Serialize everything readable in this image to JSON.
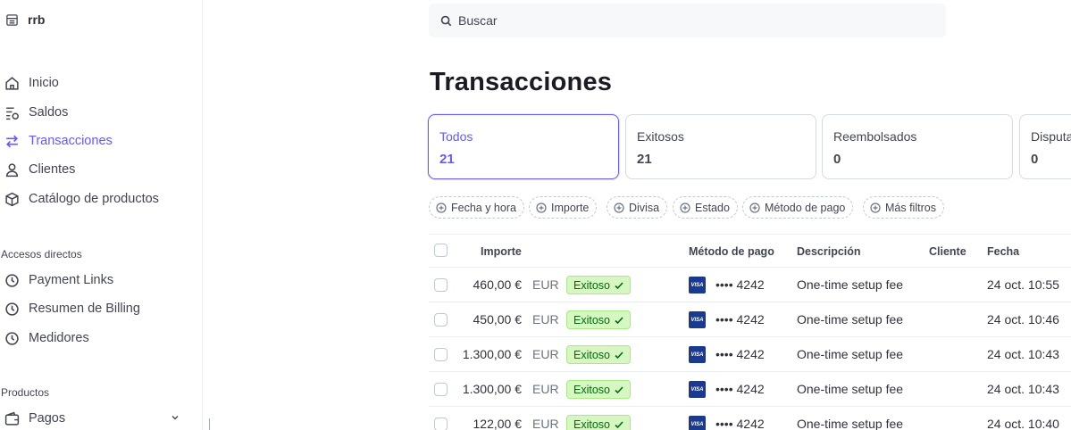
{
  "account": {
    "name": "rrb"
  },
  "nav": {
    "items": [
      {
        "label": "Inicio",
        "icon": "home-icon"
      },
      {
        "label": "Saldos",
        "icon": "balances-icon"
      },
      {
        "label": "Transacciones",
        "icon": "arrows-swap-icon",
        "active": true
      },
      {
        "label": "Clientes",
        "icon": "person-icon"
      },
      {
        "label": "Catálogo de productos",
        "icon": "box-icon"
      }
    ],
    "shortcuts_label": "Accesos directos",
    "shortcuts": [
      {
        "label": "Payment Links",
        "icon": "clock-icon"
      },
      {
        "label": "Resumen de Billing",
        "icon": "clock-icon"
      },
      {
        "label": "Medidores",
        "icon": "clock-icon"
      }
    ],
    "products_label": "Productos",
    "products": [
      {
        "label": "Pagos",
        "icon": "wallet-icon"
      }
    ]
  },
  "search": {
    "placeholder": "Buscar"
  },
  "page": {
    "title": "Transacciones"
  },
  "status_cards": [
    {
      "label": "Todos",
      "count": "21",
      "active": true
    },
    {
      "label": "Exitosos",
      "count": "21"
    },
    {
      "label": "Reembolsados",
      "count": "0"
    },
    {
      "label": "Disputa",
      "count": "0"
    }
  ],
  "filters": [
    "Fecha y hora",
    "Importe",
    "Divisa",
    "Estado",
    "Método de pago",
    "Más filtros"
  ],
  "table": {
    "headers": {
      "amount": "Importe",
      "payment_method": "Método de pago",
      "description": "Descripción",
      "customer": "Cliente",
      "date": "Fecha"
    },
    "rows": [
      {
        "amount": "460,00 €",
        "currency": "EUR",
        "status": "Exitoso",
        "card_brand": "VISA",
        "card": "•••• 4242",
        "description": "One-time setup fee",
        "customer": "",
        "date": "24 oct. 10:55"
      },
      {
        "amount": "450,00 €",
        "currency": "EUR",
        "status": "Exitoso",
        "card_brand": "VISA",
        "card": "•••• 4242",
        "description": "One-time setup fee",
        "customer": "",
        "date": "24 oct. 10:46"
      },
      {
        "amount": "1.300,00 €",
        "currency": "EUR",
        "status": "Exitoso",
        "card_brand": "VISA",
        "card": "•••• 4242",
        "description": "One-time setup fee",
        "customer": "",
        "date": "24 oct. 10:43"
      },
      {
        "amount": "1.300,00 €",
        "currency": "EUR",
        "status": "Exitoso",
        "card_brand": "VISA",
        "card": "•••• 4242",
        "description": "One-time setup fee",
        "customer": "",
        "date": "24 oct. 10:43"
      },
      {
        "amount": "122,00 €",
        "currency": "EUR",
        "status": "Exitoso",
        "card_brand": "VISA",
        "card": "•••• 4242",
        "description": "One-time setup fee",
        "customer": "",
        "date": "24 oct. 10:40"
      }
    ]
  },
  "colors": {
    "accent": "#635bff",
    "success_bg": "#d7f7c2",
    "success_text": "#05690d",
    "visa_blue": "#1a3a8f"
  }
}
